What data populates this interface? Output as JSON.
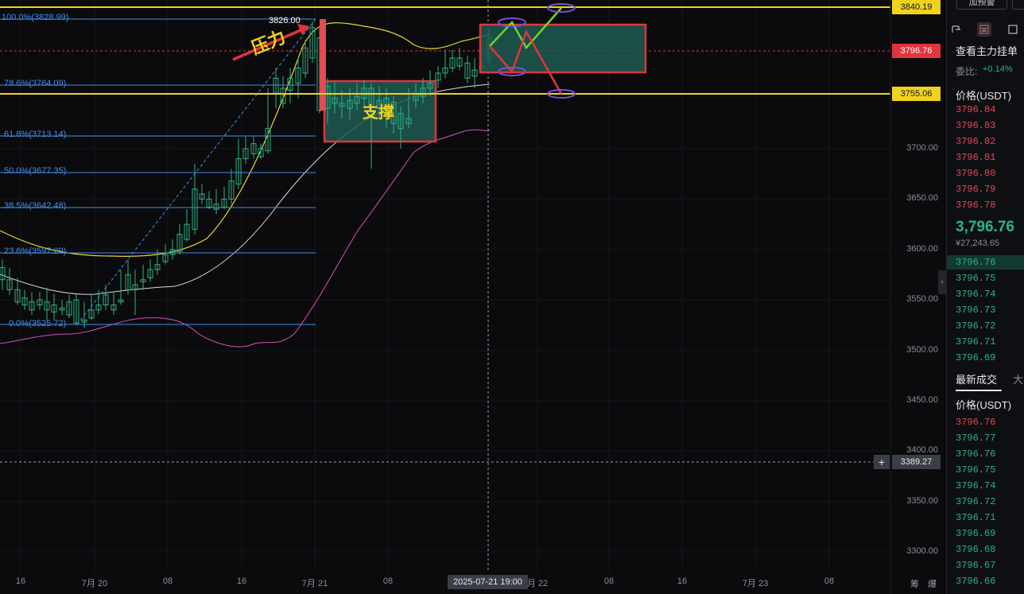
{
  "chart": {
    "y_axis_labels": [
      "3700.00",
      "3650.00",
      "3600.00",
      "3550.00",
      "3500.00",
      "3450.00",
      "3400.00",
      "3350.00",
      "3300.00"
    ],
    "x_axis_labels": [
      "16",
      "7月 20",
      "08",
      "16",
      "7月 21",
      "08",
      "月 22",
      "08",
      "16",
      "7月 23",
      "08"
    ],
    "crosshair_time": "2025-07-21 19:00",
    "crosshair_price": "3389.27",
    "price_tags": {
      "top_line": "3840.19",
      "current": "3796.76",
      "bottom_line": "3755.06"
    },
    "fib_levels": [
      {
        "label": "100.0%(3828.99)"
      },
      {
        "label": "78.6%(3764.09)"
      },
      {
        "label": "61.8%(3713.14)"
      },
      {
        "label": "50.0%(3677.35)"
      },
      {
        "label": "38.5%(3642.48)"
      },
      {
        "label": "23.6%(3597.29)"
      },
      {
        "label": "0.0%(3525.72)"
      }
    ],
    "high_marker": "3826.00",
    "annotations": {
      "pressure": "压力",
      "support": "支撑"
    },
    "corner_labels": [
      "筹",
      "爆"
    ],
    "colors": {
      "up": "#2fb285",
      "down": "#e04d52",
      "level_line": "#f0d21f",
      "box_border": "#e0353c",
      "box_fill": "#1f5a52",
      "fib": "#3f8ff0"
    }
  },
  "orderbook": {
    "top_button": "加预警",
    "title": "查看主力挂单",
    "ratio_label": "委比:",
    "ratio_value": "+0.14%",
    "price_header": "价格(USDT)",
    "asks": [
      "3796.84",
      "3796.83",
      "3796.82",
      "3796.81",
      "3796.80",
      "3796.79",
      "3796.78"
    ],
    "last_price": "3,796.76",
    "last_price_cny": "¥27,243.65",
    "bids": [
      "3796.76",
      "3796.75",
      "3796.74",
      "3796.73",
      "3796.72",
      "3796.71",
      "3796.69"
    ],
    "trades_tab": "最新成交",
    "trades_tab2": "大",
    "trades_header": "价格(USDT)",
    "trades": [
      {
        "price": "3796.76",
        "side": "sell"
      },
      {
        "price": "3796.77",
        "side": "buy"
      },
      {
        "price": "3796.76",
        "side": "buy"
      },
      {
        "price": "3796.75",
        "side": "buy"
      },
      {
        "price": "3796.74",
        "side": "buy"
      },
      {
        "price": "3796.72",
        "side": "buy"
      },
      {
        "price": "3796.71",
        "side": "buy"
      },
      {
        "price": "3796.69",
        "side": "buy"
      },
      {
        "price": "3796.68",
        "side": "buy"
      },
      {
        "price": "3796.67",
        "side": "buy"
      },
      {
        "price": "3796.66",
        "side": "buy"
      }
    ]
  }
}
